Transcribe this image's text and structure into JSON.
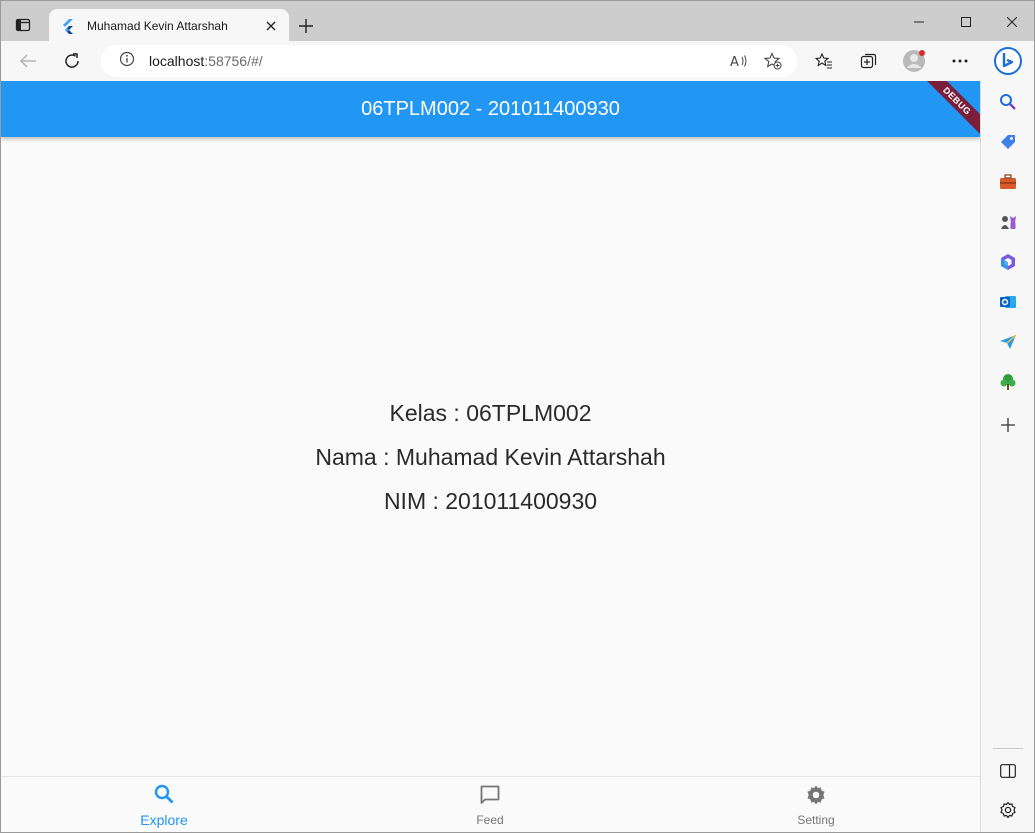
{
  "browser": {
    "tab_title": "Muhamad Kevin Attarshah",
    "url_host": "localhost",
    "url_rest": ":58756/#/"
  },
  "app": {
    "title": "06TPLM002 - 201011400930",
    "debug_banner": "DEBUG",
    "lines": [
      "Kelas : 06TPLM002",
      "Nama : Muhamad Kevin Attarshah",
      "NIM : 201011400930"
    ],
    "nav": [
      {
        "label": "Explore",
        "icon": "search-icon",
        "active": true
      },
      {
        "label": "Feed",
        "icon": "chat-icon",
        "active": false
      },
      {
        "label": "Setting",
        "icon": "gear-icon",
        "active": false
      }
    ]
  },
  "colors": {
    "primary": "#2196f3",
    "debug": "#7b1e3a",
    "inactive": "#757575"
  }
}
